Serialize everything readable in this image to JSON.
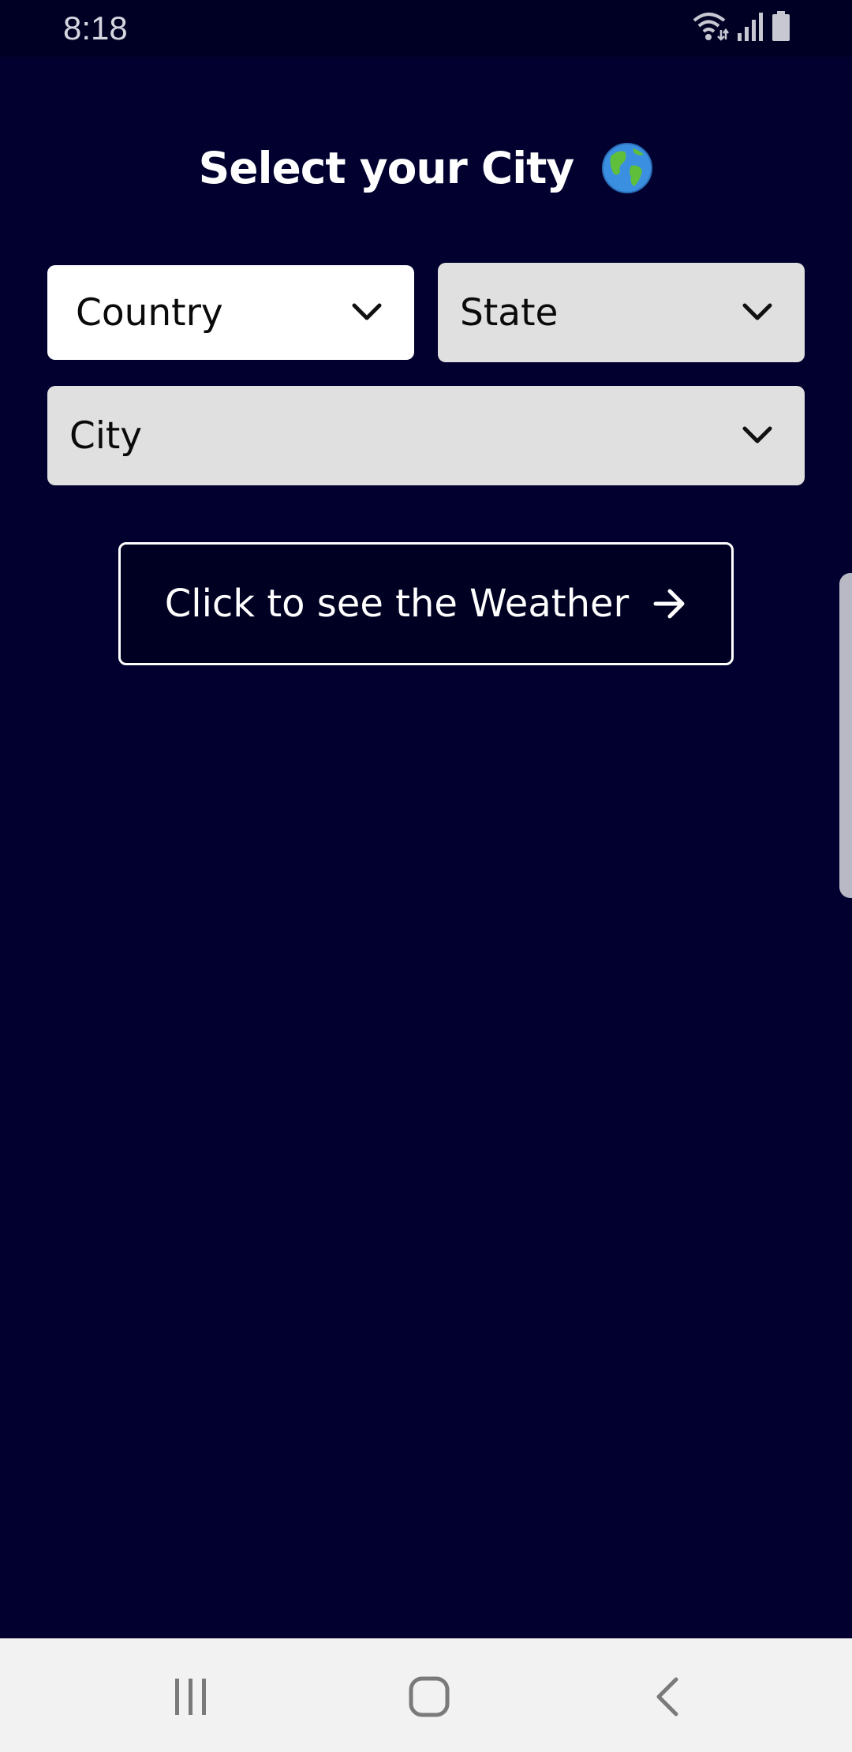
{
  "status_bar": {
    "time": "8:18",
    "icons": [
      "wifi-icon",
      "signal-icon",
      "battery-icon"
    ]
  },
  "header": {
    "title": "Select your City",
    "icon": "globe-icon"
  },
  "form": {
    "country": {
      "label": "Country",
      "icon": "chevron-down-icon"
    },
    "state": {
      "label": "State",
      "icon": "chevron-down-icon"
    },
    "city": {
      "label": "City",
      "icon": "chevron-down-icon"
    },
    "submit": {
      "label": "Click to see the Weather",
      "icon": "arrow-right-icon"
    }
  },
  "nav_bar": {
    "buttons": [
      "recents-icon",
      "home-icon",
      "back-icon"
    ]
  },
  "colors": {
    "background": "#01002f",
    "status_bar": "#000025",
    "button_background": "#000022",
    "select_active": "#ffffff",
    "select_disabled": "#e0e0e0",
    "nav_bar": "#f2f2f2"
  }
}
